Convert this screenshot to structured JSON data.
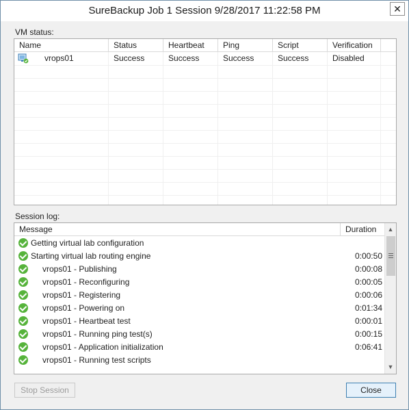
{
  "window": {
    "title": "SureBackup Job 1 Session 9/28/2017 11:22:58 PM",
    "close_glyph": "✕"
  },
  "vm_status": {
    "label": "VM status:",
    "columns": [
      "Name",
      "Status",
      "Heartbeat",
      "Ping",
      "Script",
      "Verification"
    ],
    "rows": [
      {
        "icon": "vm-icon",
        "name": "vrops01",
        "status": "Success",
        "heartbeat": "Success",
        "ping": "Success",
        "script": "Success",
        "verification": "Disabled"
      }
    ]
  },
  "session_log": {
    "label": "Session log:",
    "columns": {
      "message": "Message",
      "duration": "Duration"
    },
    "rows": [
      {
        "icon": "success-icon",
        "message": "Getting virtual lab configuration",
        "duration": "",
        "indent": false
      },
      {
        "icon": "success-icon",
        "message": "Starting virtual lab routing engine",
        "duration": "0:00:50",
        "indent": false
      },
      {
        "icon": "success-icon",
        "message": "vrops01 - Publishing",
        "duration": "0:00:08",
        "indent": true
      },
      {
        "icon": "success-icon",
        "message": "vrops01 - Reconfiguring",
        "duration": "0:00:05",
        "indent": true
      },
      {
        "icon": "success-icon",
        "message": "vrops01 - Registering",
        "duration": "0:00:06",
        "indent": true
      },
      {
        "icon": "success-icon",
        "message": "vrops01 - Powering on",
        "duration": "0:01:34",
        "indent": true
      },
      {
        "icon": "success-icon",
        "message": "vrops01 - Heartbeat test",
        "duration": "0:00:01",
        "indent": true
      },
      {
        "icon": "success-icon",
        "message": "vrops01 - Running ping test(s)",
        "duration": "0:00:15",
        "indent": true
      },
      {
        "icon": "success-icon",
        "message": "vrops01 - Application initialization",
        "duration": "0:06:41",
        "indent": true
      },
      {
        "icon": "success-icon",
        "message": "vrops01 - Running test scripts",
        "duration": "",
        "indent": true
      }
    ],
    "scroll_up_glyph": "▲",
    "scroll_down_glyph": "▼"
  },
  "buttons": {
    "stop_session": "Stop Session",
    "close": "Close"
  },
  "colors": {
    "success_green": "#56b33b",
    "primary_border": "#3c7fb1"
  }
}
